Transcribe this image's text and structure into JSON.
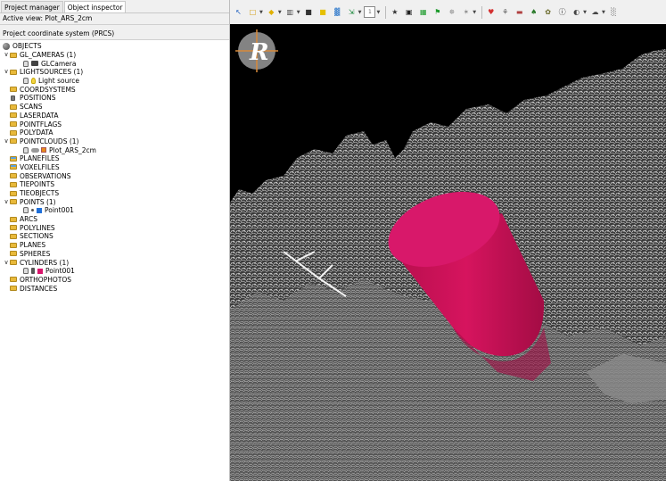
{
  "tabs": [
    {
      "label": "Project manager",
      "active": false
    },
    {
      "label": "Object inspector",
      "active": true
    }
  ],
  "active_view": "Active view: Plot_ARS_2cm",
  "coordinate_system": "Project coordinate system (PRCS)",
  "tree": [
    {
      "label": "OBJECTS",
      "level": 0,
      "icon": "objects-icon"
    },
    {
      "label": "GL_CAMERAS (1)",
      "level": 0,
      "icon": "folder-icon",
      "expanded": true
    },
    {
      "label": "GLCamera",
      "level": 1,
      "icon": "camera-icon"
    },
    {
      "label": "LIGHTSOURCES (1)",
      "level": 0,
      "icon": "folder-icon",
      "expanded": true
    },
    {
      "label": "Light source",
      "level": 1,
      "icon": "lightbulb-icon"
    },
    {
      "label": "COORDSYSTEMS",
      "level": 0,
      "icon": "folder-icon"
    },
    {
      "label": "POSITIONS",
      "level": 0,
      "icon": "positions-icon"
    },
    {
      "label": "SCANS",
      "level": 0,
      "icon": "folder-icon"
    },
    {
      "label": "LASERDATA",
      "level": 0,
      "icon": "folder-icon"
    },
    {
      "label": "POINTFLAGS",
      "level": 0,
      "icon": "folder-icon"
    },
    {
      "label": "POLYDATA",
      "level": 0,
      "icon": "folder-icon"
    },
    {
      "label": "POINTCLOUDS (1)",
      "level": 0,
      "icon": "folder-icon",
      "expanded": true
    },
    {
      "label": "Plot_ARS_2cm",
      "level": 1,
      "icon": "pointcloud-icon"
    },
    {
      "label": "PLANEFILES",
      "level": 0,
      "icon": "folder-multi-icon"
    },
    {
      "label": "VOXELFILES",
      "level": 0,
      "icon": "folder-multi-icon"
    },
    {
      "label": "OBSERVATIONS",
      "level": 0,
      "icon": "folder-icon"
    },
    {
      "label": "TIEPOINTS",
      "level": 0,
      "icon": "folder-icon"
    },
    {
      "label": "TIEOBJECTS",
      "level": 0,
      "icon": "folder-icon"
    },
    {
      "label": "POINTS (1)",
      "level": 0,
      "icon": "folder-icon",
      "expanded": true
    },
    {
      "label": "Point001",
      "level": 1,
      "icon": "point-icon"
    },
    {
      "label": "ARCS",
      "level": 0,
      "icon": "folder-icon"
    },
    {
      "label": "POLYLINES",
      "level": 0,
      "icon": "folder-icon"
    },
    {
      "label": "SECTIONS",
      "level": 0,
      "icon": "folder-icon"
    },
    {
      "label": "PLANES",
      "level": 0,
      "icon": "folder-icon"
    },
    {
      "label": "SPHERES",
      "level": 0,
      "icon": "folder-icon"
    },
    {
      "label": "CYLINDERS (1)",
      "level": 0,
      "icon": "folder-icon",
      "expanded": true
    },
    {
      "label": "Point001",
      "level": 1,
      "icon": "cylinder-icon"
    },
    {
      "label": "ORTHOPHOTOS",
      "level": 0,
      "icon": "folder-icon"
    },
    {
      "label": "DISTANCES",
      "level": 0,
      "icon": "folder-icon"
    }
  ],
  "toolbar_icons": [
    "select-icon",
    "shape-icon",
    "color-icon",
    "filter-icon",
    "cube-icon",
    "box-icon",
    "chart-icon",
    "transform-icon",
    "number-icon",
    "star-icon",
    "scatter-icon",
    "grid-icon",
    "flag-icon",
    "sparkle-icon",
    "settings-icon",
    "heart-icon",
    "tree-cluster-icon",
    "segment-icon",
    "tree-icon",
    "leaf-icon",
    "info-icon",
    "sphere-icon",
    "cloud-icon",
    "random-icon"
  ],
  "toolbar_number": "1",
  "viewport": {
    "logo_letter": "R",
    "colors": {
      "background": "#000000",
      "cylinder": "#d6145e",
      "cloud": "#b8b8b8"
    }
  }
}
